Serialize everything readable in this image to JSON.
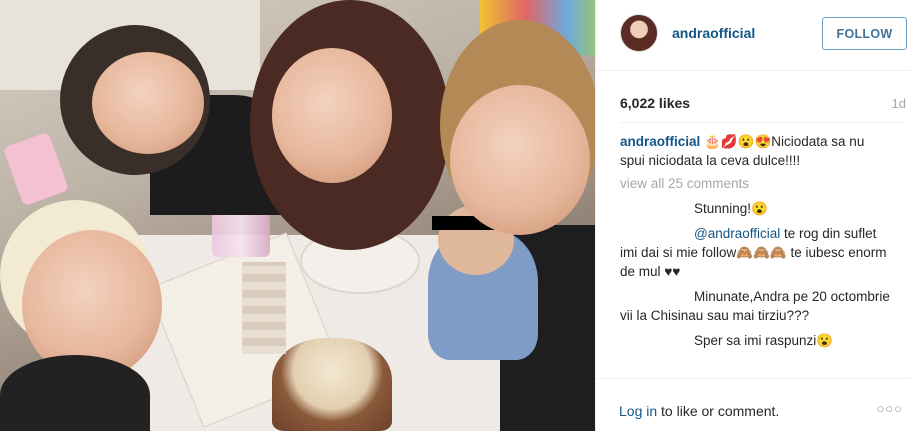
{
  "post": {
    "username": "andraofficial",
    "follow_label": "FOLLOW",
    "likes": "6,022 likes",
    "age": "1d",
    "caption_user": "andraofficial",
    "caption_text": " 🎂💋😮😍Niciodata sa nu spui niciodata la ceva dulce!!!!",
    "view_all": "view all 25 comments"
  },
  "comments": [
    {
      "text": "Stunning!😮"
    },
    {
      "mention": "@andraofficial",
      "text": " te rog din suflet imi dai si mie follow🙈🙈🙈 te iubesc enorm de mul ♥♥"
    },
    {
      "text": "Minunate,Andra pe 20 octombrie vii la Chisinau sau mai tirziu???"
    },
    {
      "text": "Sper sa imi raspunzi😮"
    }
  ],
  "footer": {
    "login_link": "Log in",
    "login_text": " to like or comment.",
    "more": "○○○"
  },
  "colors": {
    "link": "#125688",
    "follow_border": "#6aa1c8",
    "muted": "#a5a7aa"
  }
}
